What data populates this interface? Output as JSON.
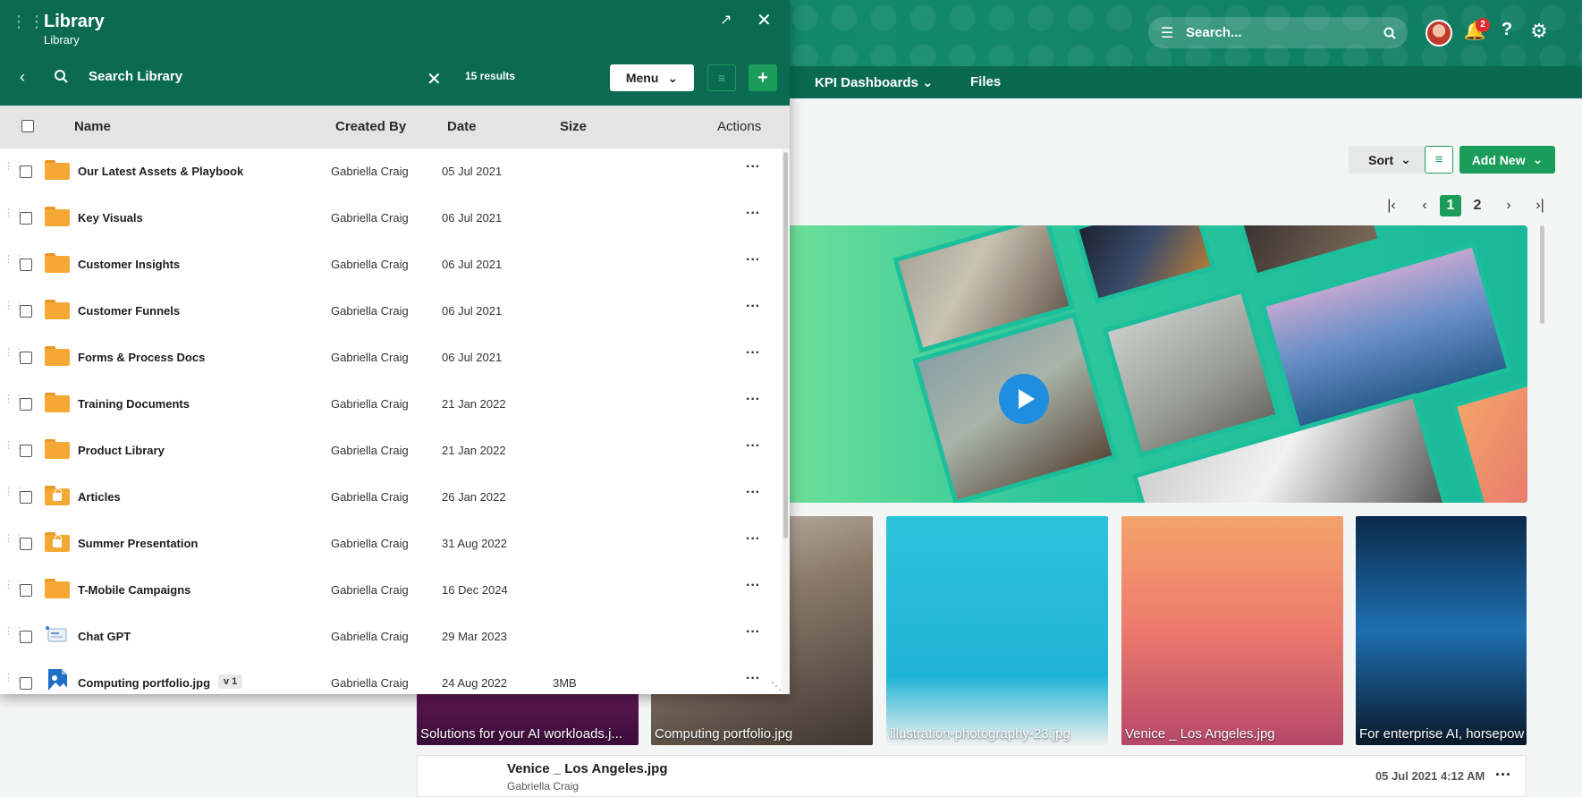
{
  "app": {
    "search_placeholder": "Search...",
    "notifications_count": "2",
    "nav": [
      "KPI Dashboards",
      "Files"
    ]
  },
  "toolbar": {
    "sort_label": "Sort",
    "add_new_label": "Add New",
    "pages": [
      "1",
      "2"
    ],
    "current_page": "1"
  },
  "cards": [
    "Solutions for your AI workloads.j...",
    "Computing portfolio.jpg",
    "illustration-photography-23.jpg",
    "Venice _ Los Angeles.jpg",
    "For enterprise AI, horsepow"
  ],
  "detail": {
    "title": "Venice _ Los Angeles.jpg",
    "author": "Gabriella Craig",
    "date": "05 Jul 2021 4:12 AM"
  },
  "panel": {
    "title": "Library",
    "subtitle": "Library",
    "search_placeholder": "Search Library",
    "results": "15 results",
    "menu_label": "Menu",
    "columns": {
      "name": "Name",
      "created_by": "Created By",
      "date": "Date",
      "size": "Size",
      "actions": "Actions"
    },
    "rows": [
      {
        "name": "Our Latest Assets & Playbook",
        "by": "Gabriella Craig",
        "date": "05 Jul 2021",
        "size": "",
        "icon": "folder-icon"
      },
      {
        "name": "Key Visuals",
        "by": "Gabriella Craig",
        "date": "06 Jul 2021",
        "size": "",
        "icon": "folder-icon"
      },
      {
        "name": "Customer Insights",
        "by": "Gabriella Craig",
        "date": "06 Jul 2021",
        "size": "",
        "icon": "folder-icon"
      },
      {
        "name": "Customer Funnels",
        "by": "Gabriella Craig",
        "date": "06 Jul 2021",
        "size": "",
        "icon": "folder-icon"
      },
      {
        "name": "Forms & Process Docs",
        "by": "Gabriella Craig",
        "date": "06 Jul 2021",
        "size": "",
        "icon": "folder-icon"
      },
      {
        "name": "Training Documents",
        "by": "Gabriella Craig",
        "date": "21 Jan 2022",
        "size": "",
        "icon": "folder-icon"
      },
      {
        "name": "Product Library",
        "by": "Gabriella Craig",
        "date": "21 Jan 2022",
        "size": "",
        "icon": "folder-icon"
      },
      {
        "name": "Articles",
        "by": "Gabriella Craig",
        "date": "26 Jan 2022",
        "size": "",
        "icon": "locked-folder-icon"
      },
      {
        "name": "Summer Presentation",
        "by": "Gabriella Craig",
        "date": "31 Aug 2022",
        "size": "",
        "icon": "locked-folder-icon"
      },
      {
        "name": "T-Mobile Campaigns",
        "by": "Gabriella Craig",
        "date": "16 Dec 2024",
        "size": "",
        "icon": "folder-icon"
      },
      {
        "name": "Chat GPT",
        "by": "Gabriella Craig",
        "date": "29 Mar 2023",
        "size": "",
        "icon": "web-link-icon"
      },
      {
        "name": "Computing portfolio.jpg",
        "by": "Gabriella Craig",
        "date": "24 Aug 2022",
        "size": "3MB",
        "icon": "image-file-icon",
        "version": "v 1"
      }
    ]
  }
}
